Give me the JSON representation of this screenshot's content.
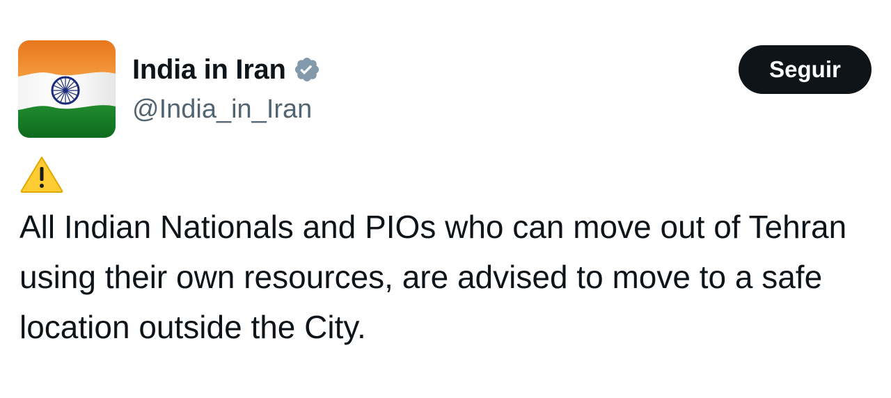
{
  "tweet": {
    "author": {
      "display_name": "India in Iran",
      "handle": "@India_in_Iran",
      "verified_icon": "verified-badge-icon",
      "avatar": "indian-flag-avatar"
    },
    "follow_button_label": "Seguir",
    "warning_icon": "warning-icon",
    "text": "All Indian Nationals and PIOs who can move out of Tehran using their own resources, are advised to move to a safe location outside the City."
  },
  "colors": {
    "follow_button_bg": "#0f1419",
    "follow_button_text": "#ffffff",
    "verified_badge": "#829aab",
    "handle_text": "#536471",
    "body_text": "#0f1419",
    "warning_yellow": "#ffcc33"
  }
}
